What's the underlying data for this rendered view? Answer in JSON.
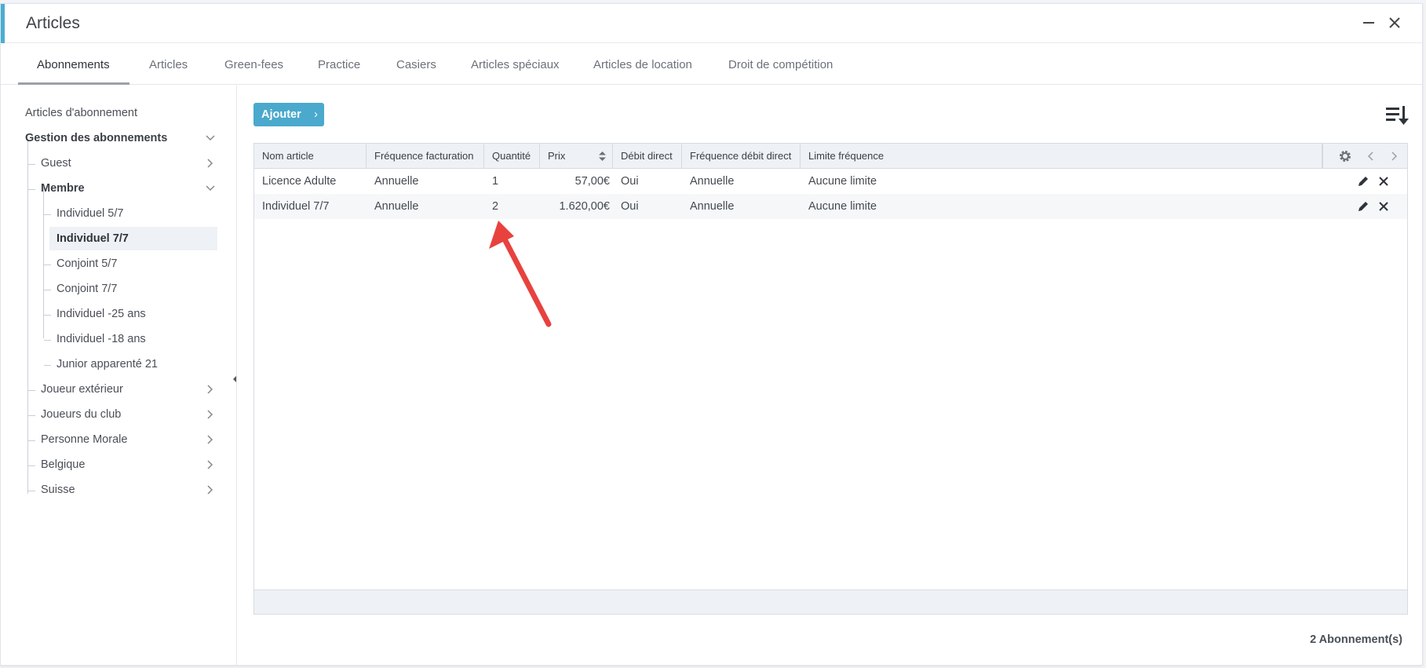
{
  "window": {
    "title": "Articles"
  },
  "tabs": [
    {
      "label": "Abonnements",
      "active": true
    },
    {
      "label": "Articles"
    },
    {
      "label": "Green-fees"
    },
    {
      "label": "Practice"
    },
    {
      "label": "Casiers"
    },
    {
      "label": "Articles spéciaux"
    },
    {
      "label": "Articles de location"
    },
    {
      "label": "Droit de compétition"
    }
  ],
  "sidebar": {
    "root_link": "Articles d'abonnement",
    "group": "Gestion des abonnements",
    "items": [
      {
        "label": "Guest"
      },
      {
        "label": "Membre"
      },
      {
        "label": "Individuel 5/7"
      },
      {
        "label": "Individuel 7/7",
        "selected": true
      },
      {
        "label": "Conjoint 5/7"
      },
      {
        "label": "Conjoint 7/7"
      },
      {
        "label": "Individuel -25 ans"
      },
      {
        "label": "Individuel -18 ans"
      },
      {
        "label": "Junior apparenté 21"
      },
      {
        "label": "Joueur extérieur"
      },
      {
        "label": "Joueurs du club"
      },
      {
        "label": "Personne Morale"
      },
      {
        "label": "Belgique"
      },
      {
        "label": "Suisse"
      }
    ]
  },
  "toolbar": {
    "add_label": "Ajouter",
    "add_arrow": "›",
    "sort_icon": "sort-descending-icon"
  },
  "table": {
    "columns": [
      "Nom article",
      "Fréquence facturation",
      "Quantité",
      "Prix",
      "Débit direct",
      "Fréquence débit direct",
      "Limite fréquence"
    ],
    "rows": [
      [
        "Licence Adulte",
        "Annuelle",
        "1",
        "57,00€",
        "Oui",
        "Annuelle",
        "Aucune limite"
      ],
      [
        "Individuel 7/7",
        "Annuelle",
        "2",
        "1.620,00€",
        "Oui",
        "Annuelle",
        "Aucune limite"
      ]
    ]
  },
  "footer": {
    "count": "2 Abonnement(s)"
  },
  "colors": {
    "accent": "#4aaed0",
    "button": "#4aa9cc",
    "annotation_arrow": "#e8423f"
  }
}
